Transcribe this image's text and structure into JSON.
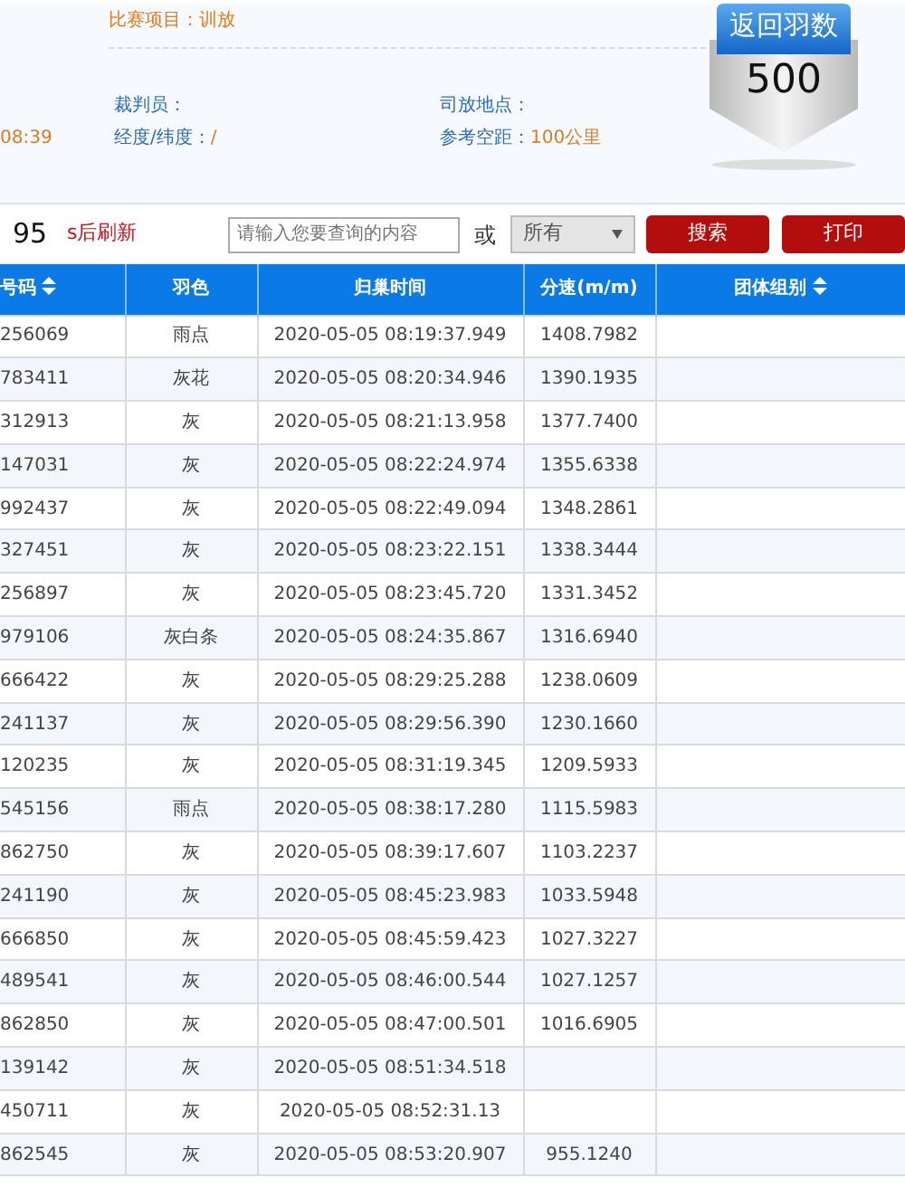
{
  "info": {
    "event": {
      "label": "比赛项目：",
      "value": "训放"
    },
    "time_fragment": "08:39",
    "referee": {
      "label": "裁判员："
    },
    "release_site": {
      "label": "司放地点："
    },
    "coords": {
      "label": "经度/纬度：",
      "value": "/"
    },
    "distance": {
      "label": "参考空距：",
      "value": "100公里"
    }
  },
  "return_badge": {
    "title": "返回羽数",
    "count": "500"
  },
  "toolbar": {
    "countdown": "95",
    "refresh_label": "s后刷新",
    "search": {
      "placeholder": "请输入您要查询的内容"
    },
    "or_label": "或",
    "filter": {
      "value": "所有"
    },
    "buttons": [
      "搜索",
      "打印"
    ]
  },
  "table": {
    "columns": [
      {
        "label": "号码",
        "sortable": true
      },
      {
        "label": "羽色",
        "sortable": false
      },
      {
        "label": "归巢时间",
        "sortable": false
      },
      {
        "label": "分速(m/m)",
        "sortable": false
      },
      {
        "label": "团体组别",
        "sortable": true
      }
    ],
    "rows": [
      {
        "ring": "256069",
        "plumage": "雨点",
        "time": "2020-05-05 08:19:37.949",
        "speed": "1408.7982"
      },
      {
        "ring": "783411",
        "plumage": "灰花",
        "time": "2020-05-05 08:20:34.946",
        "speed": "1390.1935"
      },
      {
        "ring": "312913",
        "plumage": "灰",
        "time": "2020-05-05 08:21:13.958",
        "speed": "1377.7400"
      },
      {
        "ring": "147031",
        "plumage": "灰",
        "time": "2020-05-05 08:22:24.974",
        "speed": "1355.6338"
      },
      {
        "ring": "992437",
        "plumage": "灰",
        "time": "2020-05-05 08:22:49.094",
        "speed": "1348.2861"
      },
      {
        "ring": "327451",
        "plumage": "灰",
        "time": "2020-05-05 08:23:22.151",
        "speed": "1338.3444"
      },
      {
        "ring": "256897",
        "plumage": "灰",
        "time": "2020-05-05 08:23:45.720",
        "speed": "1331.3452"
      },
      {
        "ring": "979106",
        "plumage": "灰白条",
        "time": "2020-05-05 08:24:35.867",
        "speed": "1316.6940"
      },
      {
        "ring": "666422",
        "plumage": "灰",
        "time": "2020-05-05 08:29:25.288",
        "speed": "1238.0609"
      },
      {
        "ring": "241137",
        "plumage": "灰",
        "time": "2020-05-05 08:29:56.390",
        "speed": "1230.1660"
      },
      {
        "ring": "120235",
        "plumage": "灰",
        "time": "2020-05-05 08:31:19.345",
        "speed": "1209.5933"
      },
      {
        "ring": "545156",
        "plumage": "雨点",
        "time": "2020-05-05 08:38:17.280",
        "speed": "1115.5983"
      },
      {
        "ring": "862750",
        "plumage": "灰",
        "time": "2020-05-05 08:39:17.607",
        "speed": "1103.2237"
      },
      {
        "ring": "241190",
        "plumage": "灰",
        "time": "2020-05-05 08:45:23.983",
        "speed": "1033.5948"
      },
      {
        "ring": "666850",
        "plumage": "灰",
        "time": "2020-05-05 08:45:59.423",
        "speed": "1027.3227"
      },
      {
        "ring": "489541",
        "plumage": "灰",
        "time": "2020-05-05 08:46:00.544",
        "speed": "1027.1257"
      },
      {
        "ring": "862850",
        "plumage": "灰",
        "time": "2020-05-05 08:47:00.501",
        "speed": "1016.6905"
      },
      {
        "ring": "139142",
        "plumage": "灰",
        "time": "2020-05-05 08:51:34.518"
      },
      {
        "ring": "450711",
        "plumage": "灰",
        "time": "2020-05-05 08:52:31.13"
      },
      {
        "ring": "862545",
        "plumage": "灰",
        "time": "2020-05-05 08:53:20.907",
        "speed": "955.1240"
      }
    ]
  }
}
